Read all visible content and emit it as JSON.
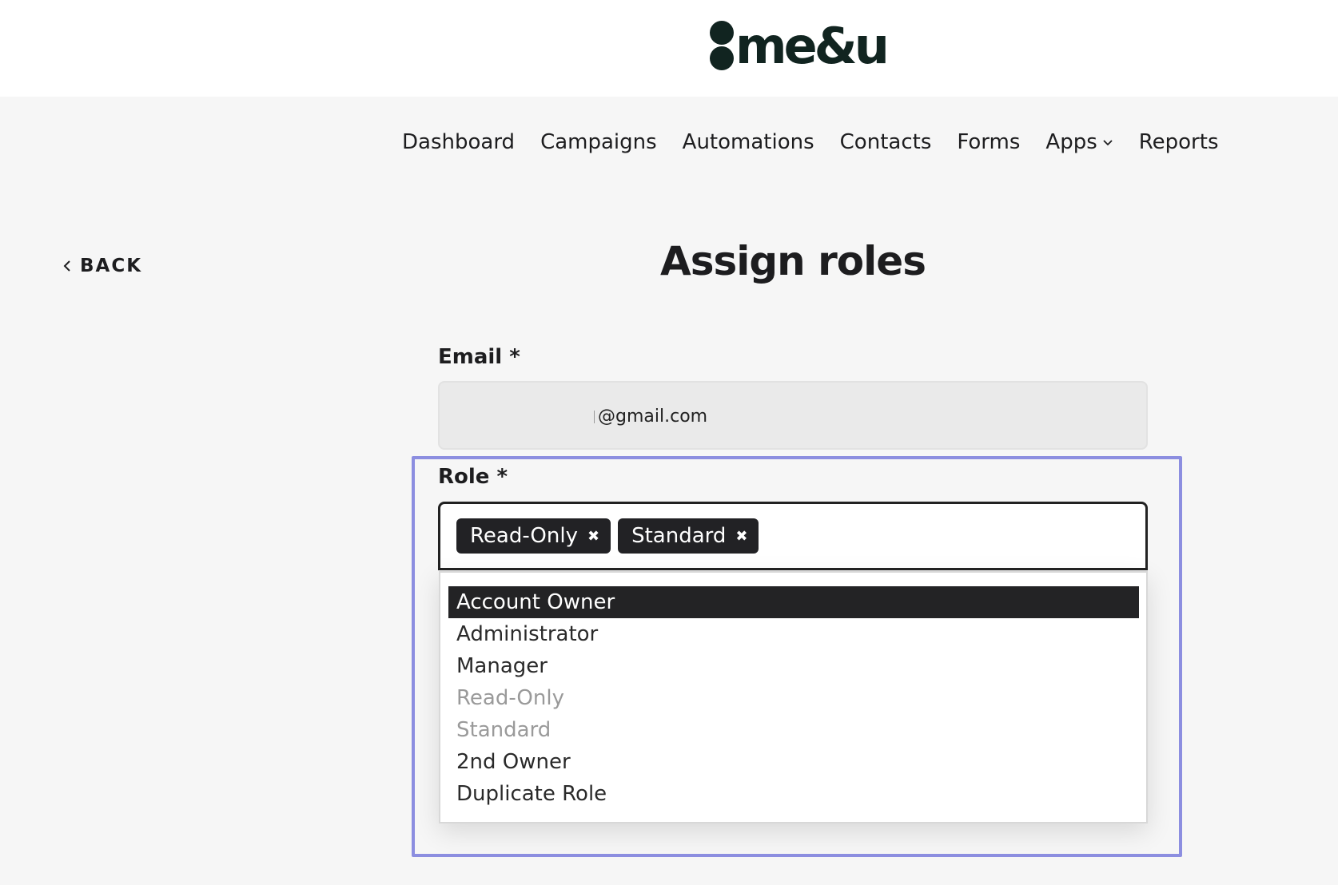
{
  "brand": {
    "logo_text": "me&u",
    "logo_color": "#112420"
  },
  "nav": {
    "items": [
      {
        "label": "Dashboard"
      },
      {
        "label": "Campaigns"
      },
      {
        "label": "Automations"
      },
      {
        "label": "Contacts"
      },
      {
        "label": "Forms"
      },
      {
        "label": "Apps",
        "has_dropdown": true
      },
      {
        "label": "Reports"
      }
    ]
  },
  "back": {
    "label": "BACK",
    "icon": "chevron-left-icon"
  },
  "page": {
    "title": "Assign roles"
  },
  "form": {
    "email": {
      "label": "Email *",
      "value": "@gmail.com"
    },
    "role": {
      "label": "Role *",
      "selected": [
        {
          "label": "Read-Only",
          "remove_glyph": "✖"
        },
        {
          "label": "Standard",
          "remove_glyph": "✖"
        }
      ],
      "options": [
        {
          "label": "Account Owner",
          "state": "highlighted"
        },
        {
          "label": "Administrator",
          "state": "normal"
        },
        {
          "label": "Manager",
          "state": "normal"
        },
        {
          "label": "Read-Only",
          "state": "disabled"
        },
        {
          "label": "Standard",
          "state": "disabled"
        },
        {
          "label": "2nd Owner",
          "state": "normal"
        },
        {
          "label": "Duplicate Role",
          "state": "normal"
        }
      ]
    }
  },
  "colors": {
    "focus_outline": "#8c8ee0",
    "tag_bg": "#222225",
    "highlight_bg": "#232325",
    "page_bg": "#f6f6f6"
  }
}
